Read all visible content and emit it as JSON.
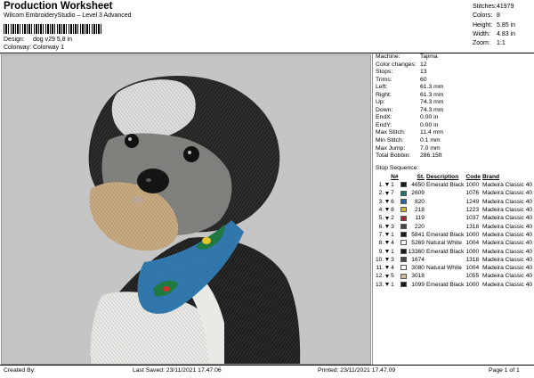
{
  "header": {
    "title": "Production Worksheet",
    "subtitle": "Wilcom EmbroideryStudio – Level 3 Advanced",
    "design_label": "Design:",
    "design_value": "dog v29 5,8 in",
    "colorway_label": "Colorway:",
    "colorway_value": "Colorway 1"
  },
  "summary": [
    {
      "label": "Stitches:",
      "value": "41979"
    },
    {
      "label": "Colors:",
      "value": "8"
    },
    {
      "label": "Height:",
      "value": "5.85 in"
    },
    {
      "label": "Width:",
      "value": "4.83 in"
    },
    {
      "label": "Zoom:",
      "value": "1:1"
    }
  ],
  "machine_info": [
    {
      "label": "Machine:",
      "value": "Tajima"
    },
    {
      "label": "Color changes:",
      "value": "12"
    },
    {
      "label": "Stops:",
      "value": "13"
    },
    {
      "label": "Trims:",
      "value": "60"
    },
    {
      "label": "Left:",
      "value": "61.3 mm"
    },
    {
      "label": "Right:",
      "value": "61.3 mm"
    },
    {
      "label": "Up:",
      "value": "74.3 mm"
    },
    {
      "label": "Down:",
      "value": "74.3 mm"
    },
    {
      "label": "EndX:",
      "value": "0.00 in"
    },
    {
      "label": "EndY:",
      "value": "0.00 in"
    },
    {
      "label": "Max Stitch:",
      "value": "11.4 mm"
    },
    {
      "label": "Min Stitch:",
      "value": "0.1 mm"
    },
    {
      "label": "Max Jump:",
      "value": "7.0 mm"
    },
    {
      "label": "Total Bobbin:",
      "value": "286.15ft"
    }
  ],
  "stop_sequence": {
    "title": "Stop Sequence:",
    "headers": {
      "n": "N#",
      "st": "St.",
      "desc": "Description",
      "code": "Code",
      "brand": "Brand"
    },
    "rows": [
      {
        "idx": "1.",
        "n": "1",
        "color": "#1a1a1a",
        "st": "4650",
        "desc": "Emerald Black",
        "code": "1000",
        "brand": "Madeira Classic 40"
      },
      {
        "idx": "2.",
        "n": "7",
        "color": "#0c7a78",
        "st": "2609",
        "desc": "",
        "code": "1076",
        "brand": "Madeira Classic 40"
      },
      {
        "idx": "3.",
        "n": "6",
        "color": "#1f66b8",
        "st": "820",
        "desc": "",
        "code": "1249",
        "brand": "Madeira Classic 40"
      },
      {
        "idx": "4.",
        "n": "8",
        "color": "#d8b21c",
        "st": "218",
        "desc": "",
        "code": "1223",
        "brand": "Madeira Classic 40"
      },
      {
        "idx": "5.",
        "n": "2",
        "color": "#b51f25",
        "st": "119",
        "desc": "",
        "code": "1037",
        "brand": "Madeira Classic 40"
      },
      {
        "idx": "6.",
        "n": "3",
        "color": "#45484a",
        "st": "220",
        "desc": "",
        "code": "1318",
        "brand": "Madeira Classic 40"
      },
      {
        "idx": "7.",
        "n": "1",
        "color": "#1a1a1a",
        "st": "5841",
        "desc": "Emerald Black",
        "code": "1000",
        "brand": "Madeira Classic 40"
      },
      {
        "idx": "8.",
        "n": "4",
        "color": "#f4f4f2",
        "st": "5269",
        "desc": "Natural White",
        "code": "1004",
        "brand": "Madeira Classic 40"
      },
      {
        "idx": "9.",
        "n": "1",
        "color": "#1a1a1a",
        "st": "13360",
        "desc": "Emerald Black",
        "code": "1000",
        "brand": "Madeira Classic 40"
      },
      {
        "idx": "10.",
        "n": "3",
        "color": "#45484a",
        "st": "1674",
        "desc": "",
        "code": "1318",
        "brand": "Madeira Classic 40"
      },
      {
        "idx": "11.",
        "n": "4",
        "color": "#f4f4f2",
        "st": "3080",
        "desc": "Natural White",
        "code": "1004",
        "brand": "Madeira Classic 40"
      },
      {
        "idx": "12.",
        "n": "5",
        "color": "#d9b98e",
        "st": "3018",
        "desc": "",
        "code": "1055",
        "brand": "Madeira Classic 40"
      },
      {
        "idx": "13.",
        "n": "1",
        "color": "#1a1a1a",
        "st": "1099",
        "desc": "Emerald Black",
        "code": "1000",
        "brand": "Madeira Classic 40"
      }
    ]
  },
  "footer": {
    "created_by": "Created By:",
    "last_saved": "Last Saved: 23/11/2021 17.47.06",
    "printed": "Printed: 23/11/2021 17.47.09",
    "page": "Page 1 of 1"
  }
}
